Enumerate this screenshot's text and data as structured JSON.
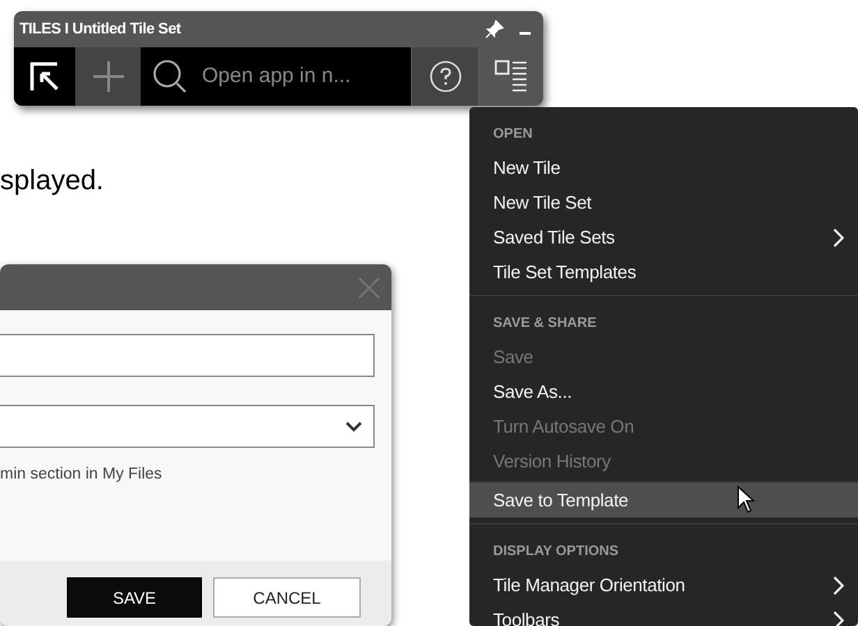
{
  "toolbar": {
    "title": "TILES I Untitled Tile Set",
    "search": {
      "placeholder": "Open app in n..."
    }
  },
  "body_text": "splayed.",
  "dialog": {
    "fields": [
      {
        "kind": "text"
      },
      {
        "kind": "select"
      }
    ],
    "help_text": "min section in My Files",
    "buttons": [
      {
        "label": "SAVE",
        "primary": true
      },
      {
        "label": "CANCEL",
        "primary": false
      }
    ]
  },
  "menu": {
    "sections": [
      {
        "heading": "OPEN",
        "items": [
          {
            "label": "New Tile",
            "disabled": false,
            "selected": false,
            "submenu": false
          },
          {
            "label": "New Tile Set",
            "disabled": false,
            "selected": false,
            "submenu": false
          },
          {
            "label": "Saved Tile Sets",
            "disabled": false,
            "selected": false,
            "submenu": true
          },
          {
            "label": "Tile Set Templates",
            "disabled": false,
            "selected": false,
            "submenu": false
          }
        ]
      },
      {
        "heading": "SAVE & SHARE",
        "items": [
          {
            "label": "Save",
            "disabled": true,
            "selected": false,
            "submenu": false
          },
          {
            "label": "Save As...",
            "disabled": false,
            "selected": false,
            "submenu": false
          },
          {
            "label": "Turn Autosave On",
            "disabled": true,
            "selected": false,
            "submenu": false
          },
          {
            "label": "Version History",
            "disabled": true,
            "selected": false,
            "submenu": false
          },
          {
            "label": "Save to Template",
            "disabled": false,
            "selected": true,
            "submenu": false
          }
        ]
      },
      {
        "heading": "DISPLAY OPTIONS",
        "items": [
          {
            "label": "Tile Manager Orientation",
            "disabled": false,
            "selected": false,
            "submenu": true
          },
          {
            "label": "Toolbars",
            "disabled": false,
            "selected": false,
            "submenu": true
          }
        ]
      }
    ]
  }
}
